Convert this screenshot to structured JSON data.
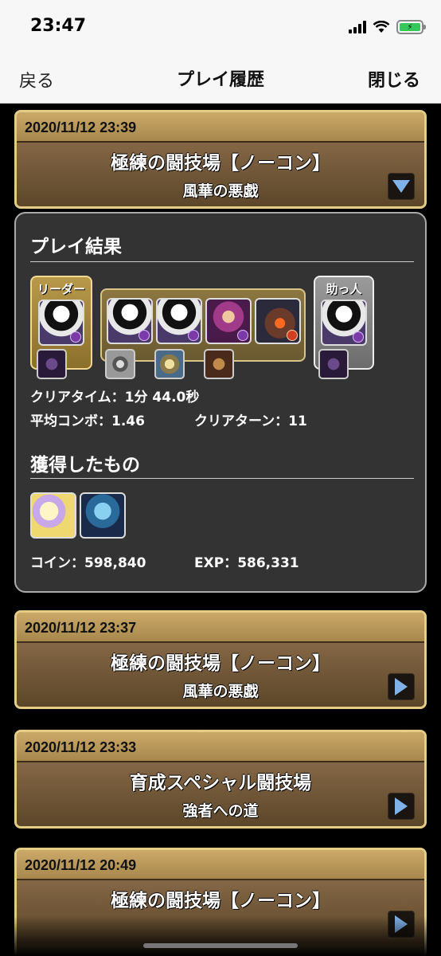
{
  "status": {
    "time": "23:47"
  },
  "nav": {
    "back": "戻る",
    "title": "プレイ履歴",
    "close": "閉じる"
  },
  "records": [
    {
      "date": "2020/11/12 23:39",
      "quest": "極練の闘技場【ノーコン】",
      "dungeon": "風華の悪戯",
      "expanded": true
    },
    {
      "date": "2020/11/12 23:37",
      "quest": "極練の闘技場【ノーコン】",
      "dungeon": "風華の悪戯",
      "expanded": false
    },
    {
      "date": "2020/11/12 23:33",
      "quest": "育成スペシャル闘技場",
      "dungeon": "強者への道",
      "expanded": false
    },
    {
      "date": "2020/11/12 20:49",
      "quest": "極練の闘技場【ノーコン】",
      "dungeon": "",
      "expanded": false
    }
  ],
  "result": {
    "title": "プレイ結果",
    "leader_label": "リーダー",
    "helper_label": "助っ人",
    "clear_time_label": "クリアタイム：",
    "clear_time": "1分 44.0秒",
    "avg_combo_label": "平均コンボ：",
    "avg_combo": "1.46",
    "clear_turn_label": "クリアターン：",
    "clear_turn": "11",
    "obtained_title": "獲得したもの",
    "coin_label": "コイン：",
    "coin": "598,840",
    "exp_label": "EXP：",
    "exp": "586,331"
  }
}
